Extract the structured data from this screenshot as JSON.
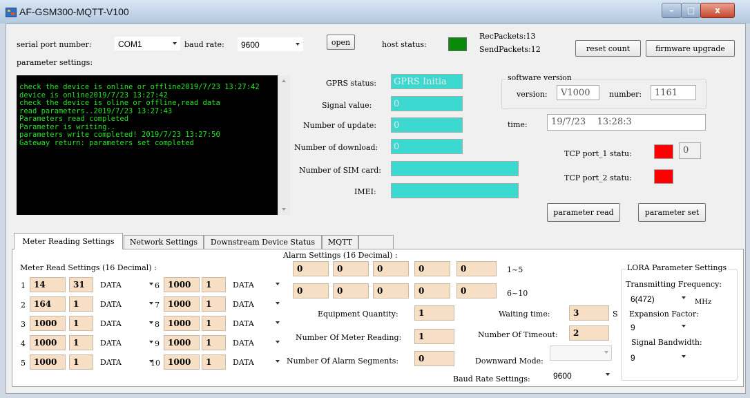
{
  "window": {
    "title": "AF-GSM300-MQTT-V100",
    "min_glyph": "–",
    "max_glyph": "□",
    "close_glyph": "x"
  },
  "top_bar": {
    "serial_port_label": "serial port number:",
    "serial_port_value": "COM1",
    "baud_rate_label": "baud rate:",
    "baud_rate_value": "9600",
    "open_button": "open",
    "host_status_label": "host status:",
    "rec_packets": "RecPackets:13",
    "send_packets": "SendPackets:12",
    "reset_count_button": "reset count",
    "firmware_upgrade_button": "firmware upgrade"
  },
  "parameter_settings_label": "parameter settings:",
  "console_lines": [
    "check the device is online or offline2019/7/23 13:27:42",
    "device is online2019/7/23 13:27:42",
    " check the device is oline or offline,read data",
    "read parameters..2019/7/23 13:27:43",
    " Parameters read completed",
    " Parameter is writing..",
    " parameters write completed! 2019/7/23 13:27:50",
    "Gateway return: parameters set completed"
  ],
  "status": {
    "gprs_status_label": "GPRS status:",
    "gprs_status_value": "GPRS Initia",
    "signal_value_label": "Signal value:",
    "signal_value": "0",
    "number_of_update_label": "Number of update:",
    "number_of_update": "0",
    "number_of_download_label": "Number of download:",
    "number_of_download": "0",
    "sim_card_label": "Number of SIM card:",
    "sim_card_value": "",
    "imei_label": "IMEI:",
    "imei_value": ""
  },
  "software_version": {
    "group_label": "software version",
    "version_label": "version:",
    "version_value": "V1000",
    "number_label": "number:",
    "number_value": "1161"
  },
  "time": {
    "label": "time:",
    "value": "19/7/23    13:28:3"
  },
  "tcp": {
    "port1_label": "TCP port_1 statu:",
    "port1_count": "0",
    "port2_label": "TCP port_2 statu:"
  },
  "buttons": {
    "parameter_read": "parameter read",
    "parameter_set": "parameter set"
  },
  "tabs": [
    {
      "label": "Meter Reading Settings"
    },
    {
      "label": "Network Settings"
    },
    {
      "label": "Downstream Device Status"
    },
    {
      "label": "MQTT"
    },
    {
      "label": ""
    }
  ],
  "meter_read": {
    "header": "Meter Read Settings (16 Decimal) :",
    "rows": [
      {
        "idx": "1",
        "a": "14",
        "b": "31",
        "type": "DATA"
      },
      {
        "idx": "2",
        "a": "164",
        "b": "1",
        "type": "DATA"
      },
      {
        "idx": "3",
        "a": "1000",
        "b": "1",
        "type": "DATA"
      },
      {
        "idx": "4",
        "a": "1000",
        "b": "1",
        "type": "DATA"
      },
      {
        "idx": "5",
        "a": "1000",
        "b": "1",
        "type": "DATA"
      },
      {
        "idx": "6",
        "a": "1000",
        "b": "1",
        "type": "DATA"
      },
      {
        "idx": "7",
        "a": "1000",
        "b": "1",
        "type": "DATA"
      },
      {
        "idx": "8",
        "a": "1000",
        "b": "1",
        "type": "DATA"
      },
      {
        "idx": "9",
        "a": "1000",
        "b": "1",
        "type": "DATA"
      },
      {
        "idx": "10",
        "a": "1000",
        "b": "1",
        "type": "DATA"
      }
    ]
  },
  "alarm": {
    "header": "Alarm Settings (16 Decimal) :",
    "row1": [
      "0",
      "0",
      "0",
      "0",
      "0"
    ],
    "row1_label": "1~5",
    "row2": [
      "0",
      "0",
      "0",
      "0",
      "0"
    ],
    "row2_label": "6~10"
  },
  "equipment": {
    "equipment_quantity_label": "Equipment Quantity:",
    "equipment_quantity": "1",
    "meter_reading_label": "Number Of Meter Reading:",
    "meter_reading": "1",
    "alarm_segments_label": "Number Of Alarm Segments:",
    "alarm_segments": "0",
    "waiting_time_label": "Waiting time:",
    "waiting_time": "3",
    "waiting_time_unit": "S",
    "timeout_label": "Number Of Timeout:",
    "timeout": "2",
    "downward_mode_label": "Downward Mode:",
    "downward_mode": "",
    "baud_rate_settings_label": "Baud Rate Settings:",
    "baud_rate_settings": "9600"
  },
  "lora": {
    "group_label": "LORA Parameter Settings",
    "tx_freq_label": "Transmitting Frequency:",
    "tx_freq_value": "6(472)",
    "tx_freq_unit": "MHz",
    "expansion_label": "Expansion Factor:",
    "expansion_value": "9",
    "bandwidth_label": "Signal Bandwidth:",
    "bandwidth_value": "9"
  },
  "colors": {
    "console_bg": "#000000",
    "console_text": "#25e425",
    "teal_field": "#3cd9d0",
    "peach_field": "#f6dfc4",
    "status_red": "#ff0000",
    "status_green": "#0a8a0a"
  }
}
